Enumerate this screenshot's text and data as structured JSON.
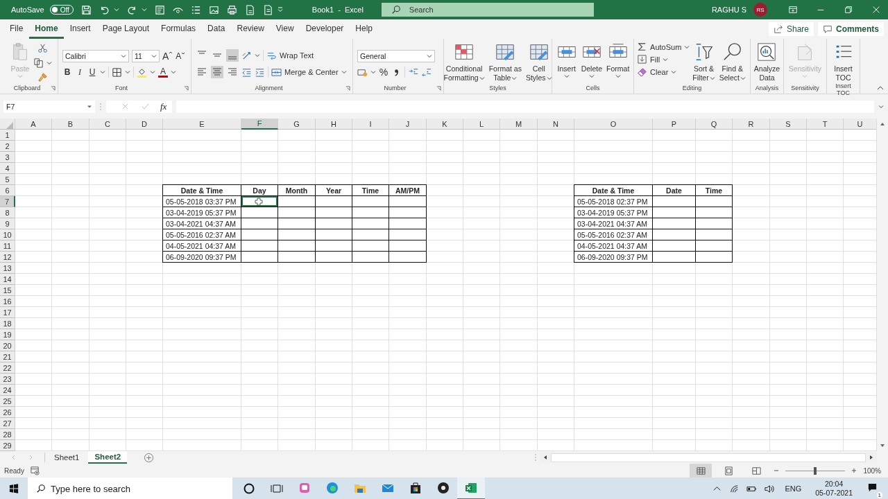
{
  "title_bar": {
    "autosave": {
      "label": "AutoSave",
      "on": false,
      "state": "Off"
    },
    "title": "Book1  -  Excel",
    "search": {
      "placeholder": "Search"
    },
    "user": "RAGHU S",
    "avatar": "RS"
  },
  "ribbon_tabs": [
    {
      "label": "File",
      "selected": false
    },
    {
      "label": "Home",
      "selected": true
    },
    {
      "label": "Insert",
      "selected": false
    },
    {
      "label": "Page Layout",
      "selected": false
    },
    {
      "label": "Formulas",
      "selected": false
    },
    {
      "label": "Data",
      "selected": false
    },
    {
      "label": "Review",
      "selected": false
    },
    {
      "label": "View",
      "selected": false
    },
    {
      "label": "Developer",
      "selected": false
    },
    {
      "label": "Help",
      "selected": false
    }
  ],
  "share": "Share",
  "comments": "Comments",
  "ribbon": {
    "clipboard": {
      "label": "Clipboard",
      "paste": {
        "label": "Paste",
        "disabled": true
      }
    },
    "font": {
      "label": "Font",
      "font_name": "Calibri",
      "font_size": "11",
      "grow_font": "A",
      "shrink_font": "A",
      "bold": "B",
      "italic": "I",
      "underline": "U",
      "font_color": "A"
    },
    "alignment": {
      "label": "Alignment",
      "vertical": [
        {
          "selected": false
        },
        {
          "selected": false
        },
        {
          "selected": true
        }
      ],
      "horizontal": [
        {
          "selected": false
        },
        {
          "selected": true
        },
        {
          "selected": false
        }
      ],
      "wrap_text": "Wrap Text",
      "merge_center": "Merge & Center"
    },
    "number": {
      "label": "Number",
      "format": "General",
      "percent": "%"
    },
    "styles": {
      "label": "Styles",
      "buttons": [
        {
          "lines": [
            "Conditional",
            "Formatting"
          ]
        },
        {
          "lines": [
            "Format as",
            "Table"
          ]
        },
        {
          "lines": [
            "Cell",
            "Styles"
          ]
        }
      ]
    },
    "cells": {
      "label": "Cells",
      "buttons": [
        "Insert",
        "Delete",
        "Format"
      ]
    },
    "editing": {
      "label": "Editing",
      "autosum": "AutoSum",
      "fill": "Fill",
      "clear": "Clear",
      "sort_filter": [
        "Sort &",
        "Filter"
      ],
      "find_select": [
        "Find &",
        "Select"
      ]
    },
    "analysis": {
      "label": "Analysis",
      "button": [
        "Analyze",
        "Data"
      ]
    },
    "sensitivity": {
      "label": "Sensitivity",
      "button": "Sensitivity",
      "disabled": true
    },
    "insert_toc": {
      "label": "Insert TOC",
      "button": [
        "Insert",
        "TOC"
      ]
    }
  },
  "formula_bar": {
    "name_box": "F7",
    "fx": "fx"
  },
  "sheet": {
    "columns": [
      {
        "label": "A",
        "selected": false
      },
      {
        "label": "B",
        "selected": false
      },
      {
        "label": "C",
        "selected": false
      },
      {
        "label": "D",
        "selected": false
      },
      {
        "label": "E",
        "selected": false
      },
      {
        "label": "F",
        "selected": true
      },
      {
        "label": "G",
        "selected": false
      },
      {
        "label": "H",
        "selected": false
      },
      {
        "label": "I",
        "selected": false
      },
      {
        "label": "J",
        "selected": false
      },
      {
        "label": "K",
        "selected": false
      },
      {
        "label": "L",
        "selected": false
      },
      {
        "label": "M",
        "selected": false
      },
      {
        "label": "N",
        "selected": false
      },
      {
        "label": "O",
        "selected": false
      },
      {
        "label": "P",
        "selected": false
      },
      {
        "label": "Q",
        "selected": false
      },
      {
        "label": "R",
        "selected": false
      },
      {
        "label": "S",
        "selected": false
      },
      {
        "label": "T",
        "selected": false
      },
      {
        "label": "U",
        "selected": false
      }
    ],
    "rows": [
      {
        "label": "1",
        "selected": false
      },
      {
        "label": "2",
        "selected": false
      },
      {
        "label": "3",
        "selected": false
      },
      {
        "label": "4",
        "selected": false
      },
      {
        "label": "5",
        "selected": false
      },
      {
        "label": "6",
        "selected": false
      },
      {
        "label": "7",
        "selected": true
      },
      {
        "label": "8",
        "selected": false
      },
      {
        "label": "9",
        "selected": false
      },
      {
        "label": "10",
        "selected": false
      },
      {
        "label": "11",
        "selected": false
      },
      {
        "label": "12",
        "selected": false
      },
      {
        "label": "13",
        "selected": false
      },
      {
        "label": "14",
        "selected": false
      },
      {
        "label": "15",
        "selected": false
      },
      {
        "label": "16",
        "selected": false
      },
      {
        "label": "17",
        "selected": false
      },
      {
        "label": "18",
        "selected": false
      },
      {
        "label": "19",
        "selected": false
      },
      {
        "label": "20",
        "selected": false
      },
      {
        "label": "21",
        "selected": false
      },
      {
        "label": "22",
        "selected": false
      },
      {
        "label": "23",
        "selected": false
      },
      {
        "label": "24",
        "selected": false
      },
      {
        "label": "25",
        "selected": false
      },
      {
        "label": "26",
        "selected": false
      },
      {
        "label": "27",
        "selected": false
      },
      {
        "label": "28",
        "selected": false
      },
      {
        "label": "29",
        "selected": false
      }
    ],
    "tables": [
      {
        "header": [
          "Date & Time",
          "Day",
          "Month",
          "Year",
          "Time",
          "AM/PM"
        ],
        "rows": [
          {
            "cells": [
              {
                "text": "05-05-2018 03:37 PM",
                "selected": false
              },
              {
                "selected": true
              },
              {
                "selected": false
              },
              {
                "selected": false
              },
              {
                "selected": false
              },
              {
                "selected": false
              }
            ]
          },
          {
            "cells": [
              {
                "text": "03-04-2019 05:37 PM",
                "selected": false
              },
              {
                "selected": false
              },
              {
                "selected": false
              },
              {
                "selected": false
              },
              {
                "selected": false
              },
              {
                "selected": false
              }
            ]
          },
          {
            "cells": [
              {
                "text": "03-04-2021 04:37 AM",
                "selected": false
              },
              {
                "selected": false
              },
              {
                "selected": false
              },
              {
                "selected": false
              },
              {
                "selected": false
              },
              {
                "selected": false
              }
            ]
          },
          {
            "cells": [
              {
                "text": "05-05-2016 02:37 AM",
                "selected": false
              },
              {
                "selected": false
              },
              {
                "selected": false
              },
              {
                "selected": false
              },
              {
                "selected": false
              },
              {
                "selected": false
              }
            ]
          },
          {
            "cells": [
              {
                "text": "04-05-2021 04:37 AM",
                "selected": false
              },
              {
                "selected": false
              },
              {
                "selected": false
              },
              {
                "selected": false
              },
              {
                "selected": false
              },
              {
                "selected": false
              }
            ]
          },
          {
            "cells": [
              {
                "text": "06-09-2020 09:37 PM",
                "selected": false
              },
              {
                "selected": false
              },
              {
                "selected": false
              },
              {
                "selected": false
              },
              {
                "selected": false
              },
              {
                "selected": false
              }
            ]
          }
        ]
      },
      {
        "header": [
          "Date & Time",
          "Date",
          "Time"
        ],
        "rows": [
          {
            "cells": [
              {
                "text": "05-05-2018 02:37 PM",
                "selected": false
              },
              {
                "selected": false
              },
              {
                "selected": false
              }
            ]
          },
          {
            "cells": [
              {
                "text": "03-04-2019 05:37 PM",
                "selected": false
              },
              {
                "selected": false
              },
              {
                "selected": false
              }
            ]
          },
          {
            "cells": [
              {
                "text": "03-04-2021 04:37 AM",
                "selected": false
              },
              {
                "selected": false
              },
              {
                "selected": false
              }
            ]
          },
          {
            "cells": [
              {
                "text": "05-05-2016 02:37 AM",
                "selected": false
              },
              {
                "selected": false
              },
              {
                "selected": false
              }
            ]
          },
          {
            "cells": [
              {
                "text": "04-05-2021 04:37 AM",
                "selected": false
              },
              {
                "selected": false
              },
              {
                "selected": false
              }
            ]
          },
          {
            "cells": [
              {
                "text": "06-09-2020 09:37 PM",
                "selected": false
              },
              {
                "selected": false
              },
              {
                "selected": false
              }
            ]
          }
        ]
      }
    ]
  },
  "sheet_tabs": [
    {
      "label": "Sheet1",
      "selected": false
    },
    {
      "label": "Sheet2",
      "selected": true
    }
  ],
  "status_bar": {
    "status": "Ready",
    "views": [
      {
        "selected": true
      },
      {
        "selected": false
      },
      {
        "selected": false
      }
    ],
    "zoom": {
      "level": 0.5,
      "reading": "100%"
    }
  },
  "taskbar": {
    "search": {
      "placeholder": "Type here to search"
    },
    "apps": [
      {
        "selected": false
      },
      {
        "selected": false
      },
      {
        "selected": false
      },
      {
        "selected": false
      },
      {
        "selected": false
      },
      {
        "selected": false
      },
      {
        "selected": true
      }
    ],
    "language": "ENG",
    "time": "20:04",
    "date": "05-07-2021",
    "notifications": "1"
  }
}
